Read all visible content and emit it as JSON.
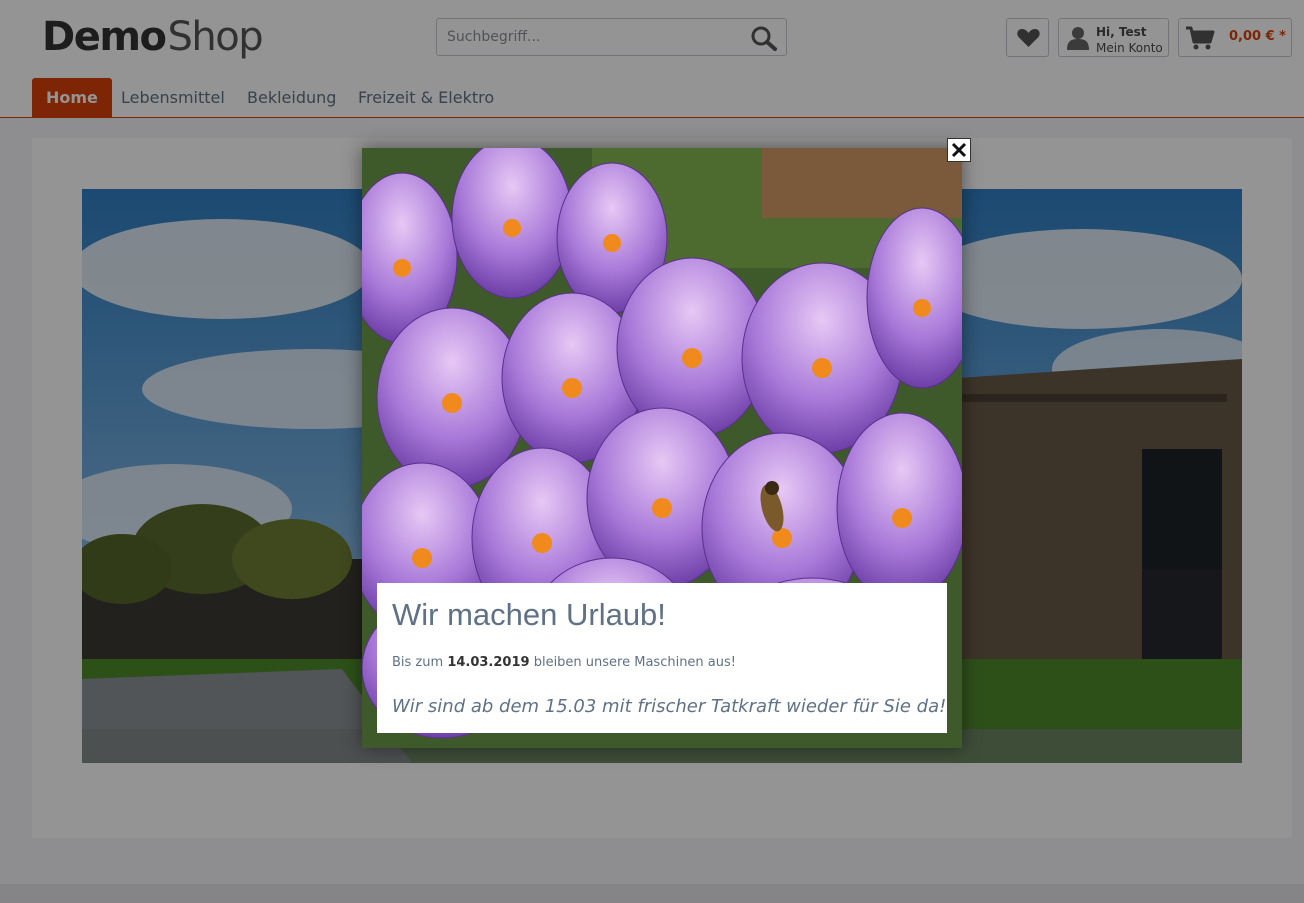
{
  "header": {
    "logo_part1": "Demo",
    "logo_part2": "Shop",
    "search_placeholder": "Suchbegriff...",
    "account_greeting": "Hi, Test",
    "account_label": "Mein Konto",
    "cart_total": "0,00 € *"
  },
  "nav": {
    "items": [
      "Home",
      "Lebensmittel",
      "Bekleidung",
      "Freizeit & Elektro"
    ]
  },
  "modal": {
    "title": "Wir machen Urlaub!",
    "line1_prefix": "Bis zum",
    "line1_date": "14.03.2019",
    "line1_suffix": "bleiben unsere Maschinen aus!",
    "line2": "Wir sind ab dem 15.03 mit frischer Tatkraft wieder für Sie da!"
  },
  "colors": {
    "accent": "#d9400b",
    "text_muted": "#5f7285"
  }
}
